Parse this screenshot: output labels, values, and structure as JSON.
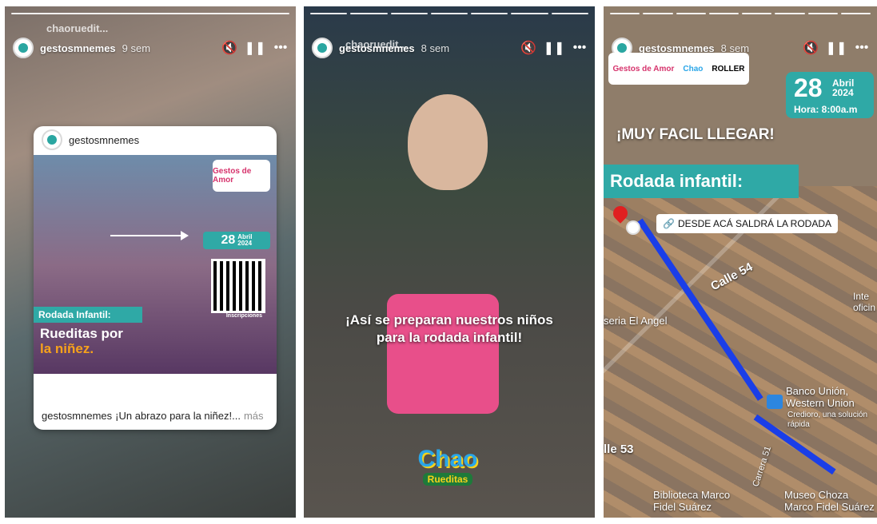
{
  "stories": [
    {
      "top_name": "chaoruedit...",
      "username": "gestosmnemes",
      "time": "9 sem",
      "card": {
        "username": "gestosmnemes",
        "caption_user": "gestosmnemes",
        "caption_text": "¡Un abrazo para la niñez!...",
        "more": "más",
        "poster": {
          "logo": "Gestos de Amor",
          "date_day": "28",
          "date_month": "Abril",
          "date_year": "2024",
          "qr_label": "Inscripciones",
          "band": "Rodada Infantil:",
          "title_line1": "Rueditas por",
          "title_line2": "la niñez."
        }
      }
    },
    {
      "top_name": "chaoruedit...",
      "username": "gestosmnemes",
      "time": "8 sem",
      "caption_line1": "¡Así se preparan nuestros niños",
      "caption_line2": "para la rodada infantil!",
      "logo_line1": "Chao",
      "logo_line2": "Rueditas"
    },
    {
      "username": "gestosmnemes",
      "time": "8 sem",
      "logos": [
        "Gestos de Amor",
        "Chao",
        "ROLLER"
      ],
      "date_day": "28",
      "date_month": "Abril",
      "date_year": "2024",
      "date_time": "Hora: 8:00a.m",
      "headline": "¡MUY FACIL LLEGAR!",
      "band": "Rodada infantil:",
      "sticker": "DESDE ACÁ SALDRÁ LA RODADA",
      "map_labels": {
        "calle54": "Calle 54",
        "calle53": "lle 53",
        "angel": "seria El Angel",
        "bank": "Banco Unión, Western Union",
        "bank_sub": "Credioro, una solución rápida",
        "carrera": "Carrera 51",
        "biblioteca": "Biblioteca Marco Fidel Suárez",
        "museo": "Museo Choza Marco Fidel Suárez",
        "inte": "Inte oficin"
      }
    }
  ]
}
